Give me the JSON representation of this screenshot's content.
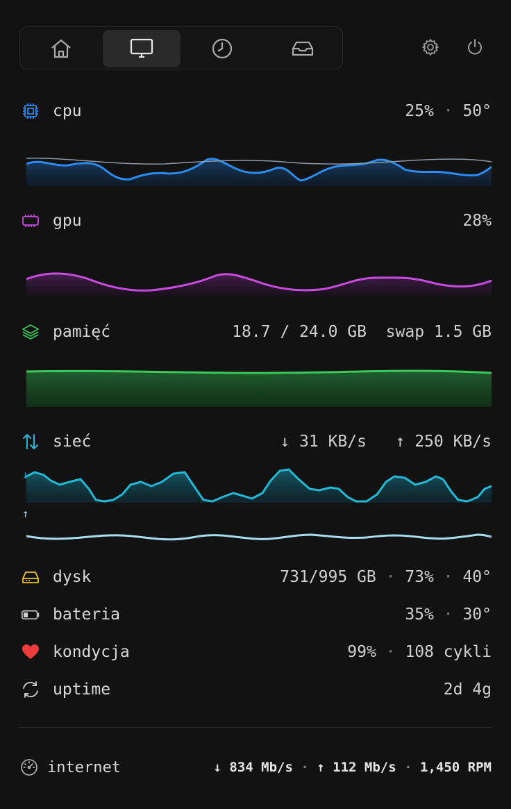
{
  "tabs": [
    {
      "name": "home",
      "icon": "home-icon",
      "active": false
    },
    {
      "name": "display",
      "icon": "monitor-icon",
      "active": true
    },
    {
      "name": "history",
      "icon": "clock-icon",
      "active": false
    },
    {
      "name": "inbox",
      "icon": "tray-icon",
      "active": false
    }
  ],
  "toolbar": {
    "settings_icon": "gear-icon",
    "power_icon": "power-icon"
  },
  "colors": {
    "cpu": "#2a8cf0",
    "gpu": "#c94ae0",
    "memory": "#3cc85a",
    "network": "#22b8d6",
    "network_up": "#a8dcef",
    "disk": "#f2c230",
    "battery": "#cfcfcf",
    "health": "#ef3d3d"
  },
  "cpu": {
    "label": "cpu",
    "usage": "25%",
    "sep": "·",
    "temp": "50°",
    "icon": "processor-chip-icon"
  },
  "gpu": {
    "label": "gpu",
    "usage": "28%",
    "icon": "gpu-card-icon"
  },
  "memory": {
    "label": "pamięć",
    "used": "18.7 / 24.0 GB",
    "swap": "swap 1.5 GB",
    "icon": "layers-icon"
  },
  "network": {
    "label": "sieć",
    "down": "↓ 31 KB/s",
    "up": "↑ 250 KB/s",
    "icon": "arrows-up-down-icon",
    "down_marker": "↓",
    "up_marker": "↑"
  },
  "disk": {
    "label": "dysk",
    "used": "731/995 GB",
    "percent": "73%",
    "temp": "40°",
    "icon": "hard-drive-icon"
  },
  "battery": {
    "label": "bateria",
    "percent": "35%",
    "temp": "30°",
    "icon": "battery-icon"
  },
  "health": {
    "label": "kondycja",
    "percent": "99%",
    "cycles": "108 cykli",
    "icon": "heart-icon"
  },
  "uptime": {
    "label": "uptime",
    "value": "2d 4g",
    "icon": "refresh-cycle-icon"
  },
  "footer": {
    "label": "internet",
    "download": "↓ 834 Mb/s",
    "upload": "↑ 112 Mb/s",
    "fan": "1,450 RPM",
    "icon": "speedometer-icon"
  }
}
